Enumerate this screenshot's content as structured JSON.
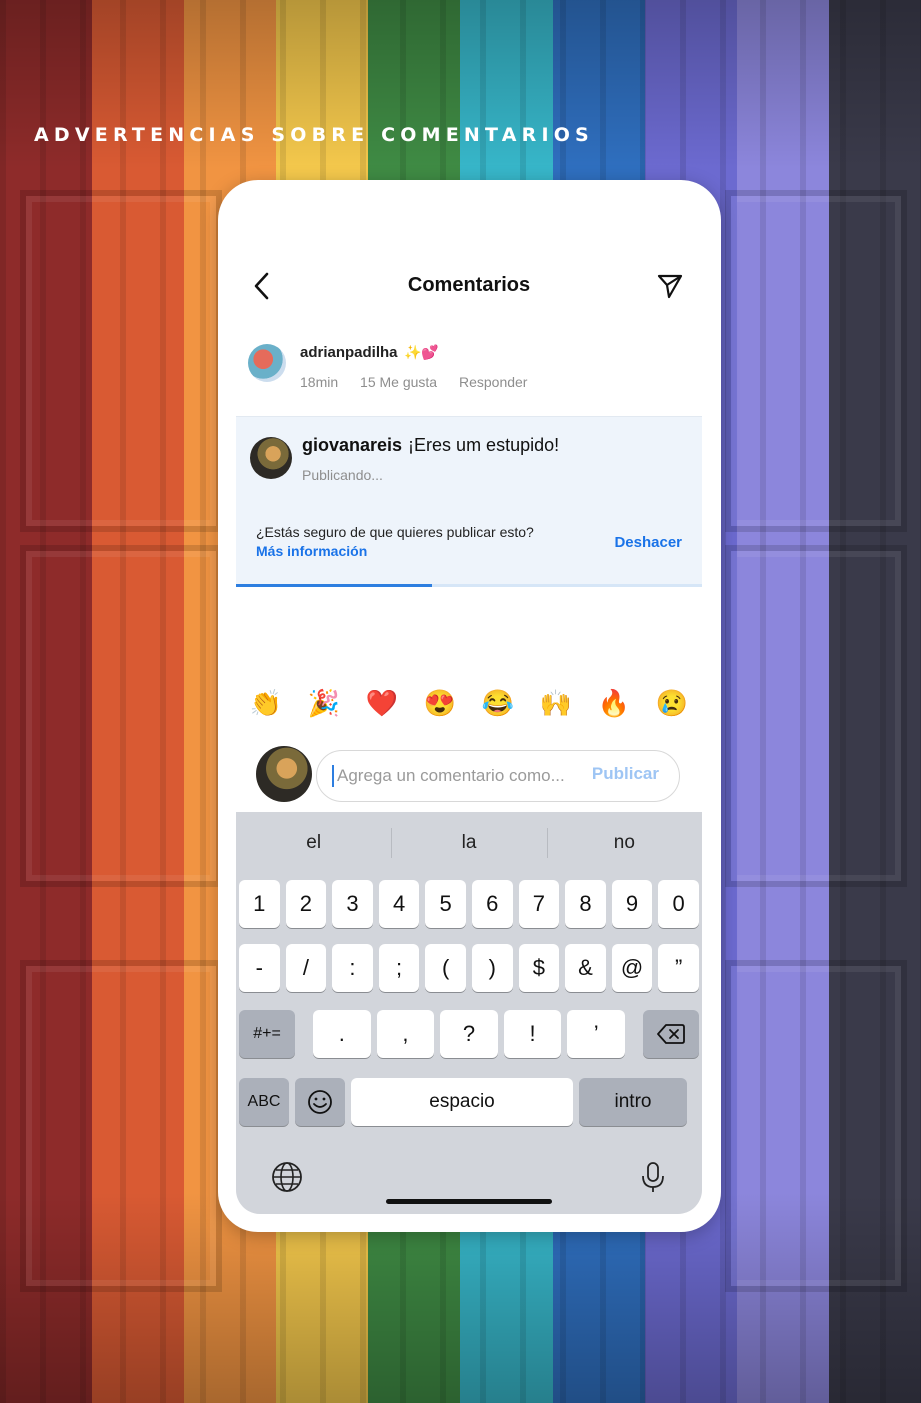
{
  "headline": "ADVERTENCIAS SOBRE COMENTARIOS",
  "background_stripes": [
    "#8e2b2a",
    "#d95a33",
    "#f19442",
    "#f4c84c",
    "#3f8b44",
    "#37b6c9",
    "#2f6fbf",
    "#6c6ad0",
    "#8c86dc",
    "#3a3a4a"
  ],
  "screen": {
    "title": "Comentarios",
    "icons": {
      "back": "chevron-left-icon",
      "send": "paper-plane-icon"
    },
    "comment1": {
      "username": "adrianpadilha",
      "emoji": "✨💕",
      "time": "18min",
      "likes": "15 Me gusta",
      "reply": "Responder"
    },
    "comment2": {
      "username": "giovanareis",
      "text": "¡Eres um estupido!",
      "status": "Publicando..."
    },
    "warning": {
      "question": "¿Estás seguro de que quieres publicar esto?",
      "more_info": "Más información",
      "undo": "Deshacer",
      "progress": 0.42
    },
    "emoji_bar": [
      "👏",
      "🎉",
      "❤️",
      "😍",
      "😂",
      "🙌",
      "🔥",
      "😢"
    ],
    "composer": {
      "placeholder": "Agrega un comentario como...",
      "post": "Publicar"
    }
  },
  "keyboard": {
    "suggestions": [
      "el",
      "la",
      "no"
    ],
    "row1": [
      "1",
      "2",
      "3",
      "4",
      "5",
      "6",
      "7",
      "8",
      "9",
      "0"
    ],
    "row2": [
      "-",
      "/",
      ":",
      ";",
      "(",
      ")",
      "$",
      "&",
      "@",
      "”"
    ],
    "row3_mode": "#+=",
    "row3": [
      ".",
      ",",
      "?",
      "!",
      "’"
    ],
    "abc": "ABC",
    "space": "espacio",
    "return": "intro",
    "icons": {
      "delete": "backspace-icon",
      "emoji": "emoji-icon",
      "globe": "globe-icon",
      "mic": "microphone-icon"
    }
  }
}
